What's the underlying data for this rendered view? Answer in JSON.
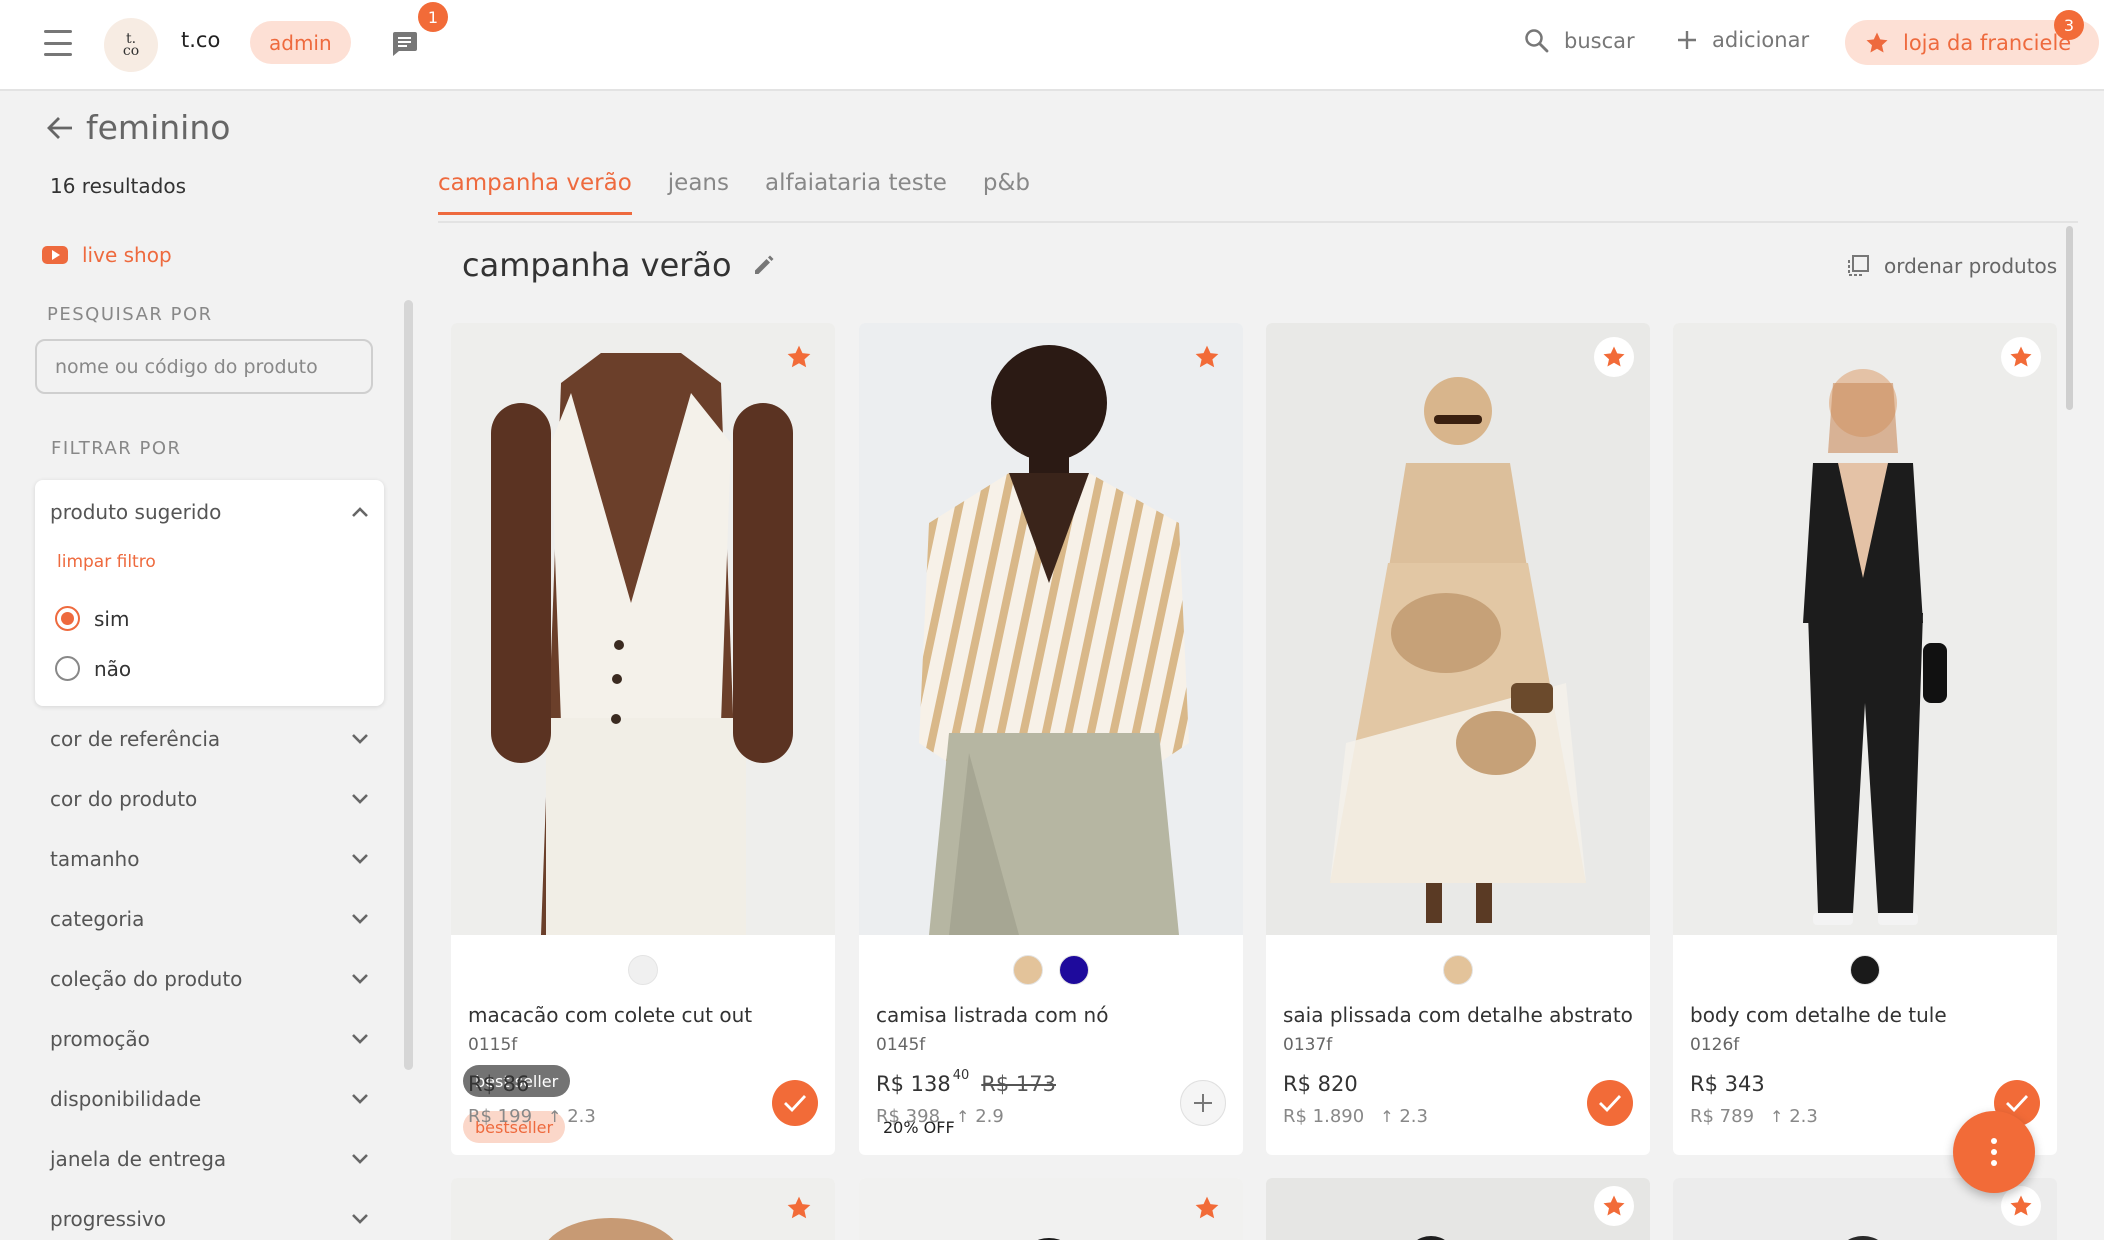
{
  "topbar": {
    "menu_icon": "hamburger-icon",
    "logo_text": "t.co",
    "brand": "t.co",
    "role_badge": "admin",
    "chat_icon": "chat-icon",
    "chat_count": "1",
    "search_label": "buscar",
    "add_label": "adicionar",
    "store_label": "loja da franciele",
    "store_count": "3"
  },
  "sidebar": {
    "title": "feminino",
    "results": "16 resultados",
    "live_shop": "live shop",
    "search_section": "PESQUISAR POR",
    "search_placeholder": "nome ou código do produto",
    "filter_section": "FILTRAR POR",
    "open_filter": {
      "label": "produto sugerido",
      "clear": "limpar filtro",
      "options": [
        {
          "label": "sim",
          "selected": true
        },
        {
          "label": "não",
          "selected": false
        }
      ]
    },
    "facets": [
      "cor de referência",
      "cor do produto",
      "tamanho",
      "categoria",
      "coleção do produto",
      "promoção",
      "disponibilidade",
      "janela de entrega",
      "progressivo"
    ]
  },
  "tabs": [
    "campanha verão",
    "jeans",
    "alfaiataria teste",
    "p&b"
  ],
  "active_tab": "campanha verão",
  "section": {
    "title": "campanha verão",
    "order_label": "ordenar produtos"
  },
  "colors": {
    "accent": "#ee6a3e",
    "accent_bg": "#fde0d5",
    "page_bg": "#f2f2f2"
  },
  "products": [
    {
      "name": "macacão com colete cut out",
      "code": "0115f",
      "price": "R$ 86",
      "price_cents": "",
      "old_price": "",
      "list_price": "R$ 199",
      "markup": "2.3",
      "badges": [
        "best seller",
        "bestseller"
      ],
      "swatches": [
        "#f0f0f0"
      ],
      "selected": true
    },
    {
      "name": "camisa listrada com nó",
      "code": "0145f",
      "price": "R$ 138",
      "price_cents": "40",
      "old_price": "R$ 173",
      "list_price": "R$ 398",
      "markup": "2.9",
      "badges": [
        "20% OFF"
      ],
      "swatches": [
        "#e3c39a",
        "#1e0a9c"
      ],
      "selected": false
    },
    {
      "name": "saia plissada com detalhe abstrato",
      "code": "0137f",
      "price": "R$ 820",
      "price_cents": "",
      "old_price": "",
      "list_price": "R$ 1.890",
      "markup": "2.3",
      "badges": [],
      "swatches": [
        "#e3c39a"
      ],
      "selected": true
    },
    {
      "name": "body com detalhe de tule",
      "code": "0126f",
      "price": "R$ 343",
      "price_cents": "",
      "old_price": "",
      "list_price": "R$ 789",
      "markup": "2.3",
      "badges": [],
      "swatches": [
        "#1a1a1a"
      ],
      "selected": true
    }
  ],
  "fab_icon": "more-vertical-icon"
}
